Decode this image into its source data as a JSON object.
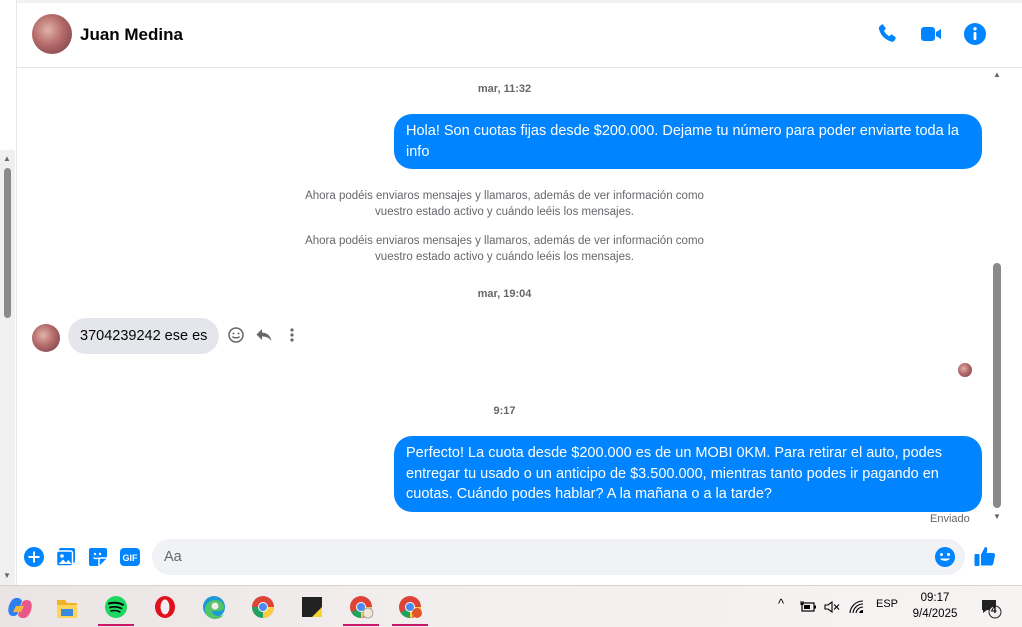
{
  "header": {
    "contact_name": "Juan Medina"
  },
  "messages": {
    "ts1": "mar, 11:32",
    "out1": "Hola! Son cuotas fijas desde $200.000. Dejame tu número para poder enviarte toda la info",
    "sys1_line1": "Ahora podéis enviaros mensajes y llamaros, además de ver información como",
    "sys1_line2": "vuestro estado activo y cuándo leéis los mensajes.",
    "sys2_line1": "Ahora podéis enviaros mensajes y llamaros, además de ver información como",
    "sys2_line2": "vuestro estado activo y cuándo leéis los mensajes.",
    "ts2": "mar, 19:04",
    "in1": "3704239242 ese es",
    "ts3": "9:17",
    "out2": "Perfecto! La cuota desde $200.000 es de un MOBI 0KM. Para retirar el auto, podes entregar tu usado o un anticipo de $3.500.000, mientras tanto podes ir pagando en cuotas. Cuándo podes hablar? A la mañana o a la tarde?",
    "status": "Enviado"
  },
  "composer": {
    "placeholder": "Aa"
  },
  "taskbar": {
    "language": "ESP",
    "time": "09:17",
    "date": "9/4/2025",
    "notification_count": "4"
  },
  "colors": {
    "accent": "#0084ff",
    "incoming_bubble": "#e4e6eb"
  }
}
